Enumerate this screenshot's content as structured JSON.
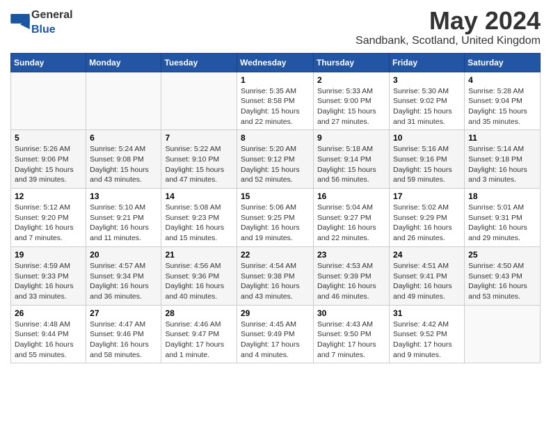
{
  "logo": {
    "general": "General",
    "blue": "Blue"
  },
  "title": "May 2024",
  "location": "Sandbank, Scotland, United Kingdom",
  "days_of_week": [
    "Sunday",
    "Monday",
    "Tuesday",
    "Wednesday",
    "Thursday",
    "Friday",
    "Saturday"
  ],
  "weeks": [
    [
      {
        "day": "",
        "info": ""
      },
      {
        "day": "",
        "info": ""
      },
      {
        "day": "",
        "info": ""
      },
      {
        "day": "1",
        "info": "Sunrise: 5:35 AM\nSunset: 8:58 PM\nDaylight: 15 hours\nand 22 minutes."
      },
      {
        "day": "2",
        "info": "Sunrise: 5:33 AM\nSunset: 9:00 PM\nDaylight: 15 hours\nand 27 minutes."
      },
      {
        "day": "3",
        "info": "Sunrise: 5:30 AM\nSunset: 9:02 PM\nDaylight: 15 hours\nand 31 minutes."
      },
      {
        "day": "4",
        "info": "Sunrise: 5:28 AM\nSunset: 9:04 PM\nDaylight: 15 hours\nand 35 minutes."
      }
    ],
    [
      {
        "day": "5",
        "info": "Sunrise: 5:26 AM\nSunset: 9:06 PM\nDaylight: 15 hours\nand 39 minutes."
      },
      {
        "day": "6",
        "info": "Sunrise: 5:24 AM\nSunset: 9:08 PM\nDaylight: 15 hours\nand 43 minutes."
      },
      {
        "day": "7",
        "info": "Sunrise: 5:22 AM\nSunset: 9:10 PM\nDaylight: 15 hours\nand 47 minutes."
      },
      {
        "day": "8",
        "info": "Sunrise: 5:20 AM\nSunset: 9:12 PM\nDaylight: 15 hours\nand 52 minutes."
      },
      {
        "day": "9",
        "info": "Sunrise: 5:18 AM\nSunset: 9:14 PM\nDaylight: 15 hours\nand 56 minutes."
      },
      {
        "day": "10",
        "info": "Sunrise: 5:16 AM\nSunset: 9:16 PM\nDaylight: 15 hours\nand 59 minutes."
      },
      {
        "day": "11",
        "info": "Sunrise: 5:14 AM\nSunset: 9:18 PM\nDaylight: 16 hours\nand 3 minutes."
      }
    ],
    [
      {
        "day": "12",
        "info": "Sunrise: 5:12 AM\nSunset: 9:20 PM\nDaylight: 16 hours\nand 7 minutes."
      },
      {
        "day": "13",
        "info": "Sunrise: 5:10 AM\nSunset: 9:21 PM\nDaylight: 16 hours\nand 11 minutes."
      },
      {
        "day": "14",
        "info": "Sunrise: 5:08 AM\nSunset: 9:23 PM\nDaylight: 16 hours\nand 15 minutes."
      },
      {
        "day": "15",
        "info": "Sunrise: 5:06 AM\nSunset: 9:25 PM\nDaylight: 16 hours\nand 19 minutes."
      },
      {
        "day": "16",
        "info": "Sunrise: 5:04 AM\nSunset: 9:27 PM\nDaylight: 16 hours\nand 22 minutes."
      },
      {
        "day": "17",
        "info": "Sunrise: 5:02 AM\nSunset: 9:29 PM\nDaylight: 16 hours\nand 26 minutes."
      },
      {
        "day": "18",
        "info": "Sunrise: 5:01 AM\nSunset: 9:31 PM\nDaylight: 16 hours\nand 29 minutes."
      }
    ],
    [
      {
        "day": "19",
        "info": "Sunrise: 4:59 AM\nSunset: 9:33 PM\nDaylight: 16 hours\nand 33 minutes."
      },
      {
        "day": "20",
        "info": "Sunrise: 4:57 AM\nSunset: 9:34 PM\nDaylight: 16 hours\nand 36 minutes."
      },
      {
        "day": "21",
        "info": "Sunrise: 4:56 AM\nSunset: 9:36 PM\nDaylight: 16 hours\nand 40 minutes."
      },
      {
        "day": "22",
        "info": "Sunrise: 4:54 AM\nSunset: 9:38 PM\nDaylight: 16 hours\nand 43 minutes."
      },
      {
        "day": "23",
        "info": "Sunrise: 4:53 AM\nSunset: 9:39 PM\nDaylight: 16 hours\nand 46 minutes."
      },
      {
        "day": "24",
        "info": "Sunrise: 4:51 AM\nSunset: 9:41 PM\nDaylight: 16 hours\nand 49 minutes."
      },
      {
        "day": "25",
        "info": "Sunrise: 4:50 AM\nSunset: 9:43 PM\nDaylight: 16 hours\nand 53 minutes."
      }
    ],
    [
      {
        "day": "26",
        "info": "Sunrise: 4:48 AM\nSunset: 9:44 PM\nDaylight: 16 hours\nand 55 minutes."
      },
      {
        "day": "27",
        "info": "Sunrise: 4:47 AM\nSunset: 9:46 PM\nDaylight: 16 hours\nand 58 minutes."
      },
      {
        "day": "28",
        "info": "Sunrise: 4:46 AM\nSunset: 9:47 PM\nDaylight: 17 hours\nand 1 minute."
      },
      {
        "day": "29",
        "info": "Sunrise: 4:45 AM\nSunset: 9:49 PM\nDaylight: 17 hours\nand 4 minutes."
      },
      {
        "day": "30",
        "info": "Sunrise: 4:43 AM\nSunset: 9:50 PM\nDaylight: 17 hours\nand 7 minutes."
      },
      {
        "day": "31",
        "info": "Sunrise: 4:42 AM\nSunset: 9:52 PM\nDaylight: 17 hours\nand 9 minutes."
      },
      {
        "day": "",
        "info": ""
      }
    ]
  ]
}
